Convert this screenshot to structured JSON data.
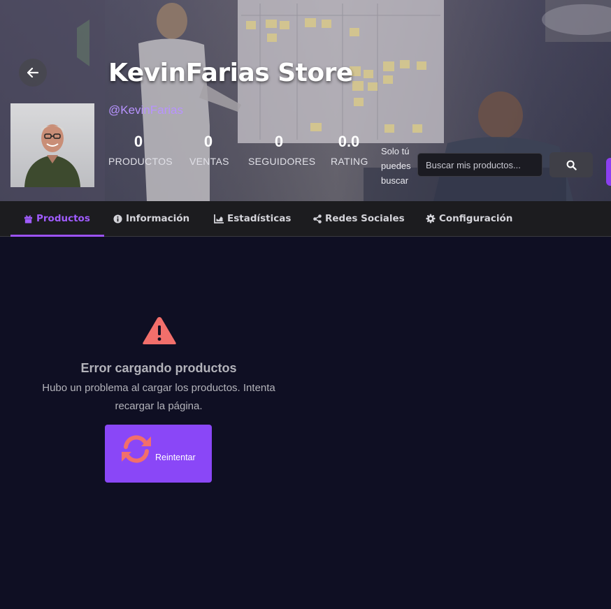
{
  "store": {
    "title": "KevinFarias Store",
    "handle": "@KevinFarias",
    "stats": [
      {
        "value": "0",
        "label": "PRODUCTOS"
      },
      {
        "value": "0",
        "label": "VENTAS"
      },
      {
        "value": "0",
        "label": "SEGUIDORES"
      },
      {
        "value": "0.0",
        "label": "RATING"
      }
    ],
    "search_note": "Solo tú puedes buscar",
    "search_placeholder": "Buscar mis productos..."
  },
  "tabs": [
    {
      "label": "Productos",
      "icon": "gift-icon",
      "active": true
    },
    {
      "label": "Información",
      "icon": "info-circle-icon",
      "active": false
    },
    {
      "label": "Estadísticas",
      "icon": "chart-area-icon",
      "active": false
    },
    {
      "label": "Redes Sociales",
      "icon": "share-alt-icon",
      "active": false
    },
    {
      "label": "Configuración",
      "icon": "gear-icon",
      "active": false
    }
  ],
  "error": {
    "title": "Error cargando productos",
    "message": "Hubo un problema al cargar los productos. Intenta recargar la página.",
    "retry_label": "Reintentar"
  },
  "colors": {
    "accent": "#9b52f5",
    "handle": "#b893ff",
    "error_icon": "#f26f6b",
    "background": "#0f0f23",
    "tabbar": "#1c1c1f"
  }
}
